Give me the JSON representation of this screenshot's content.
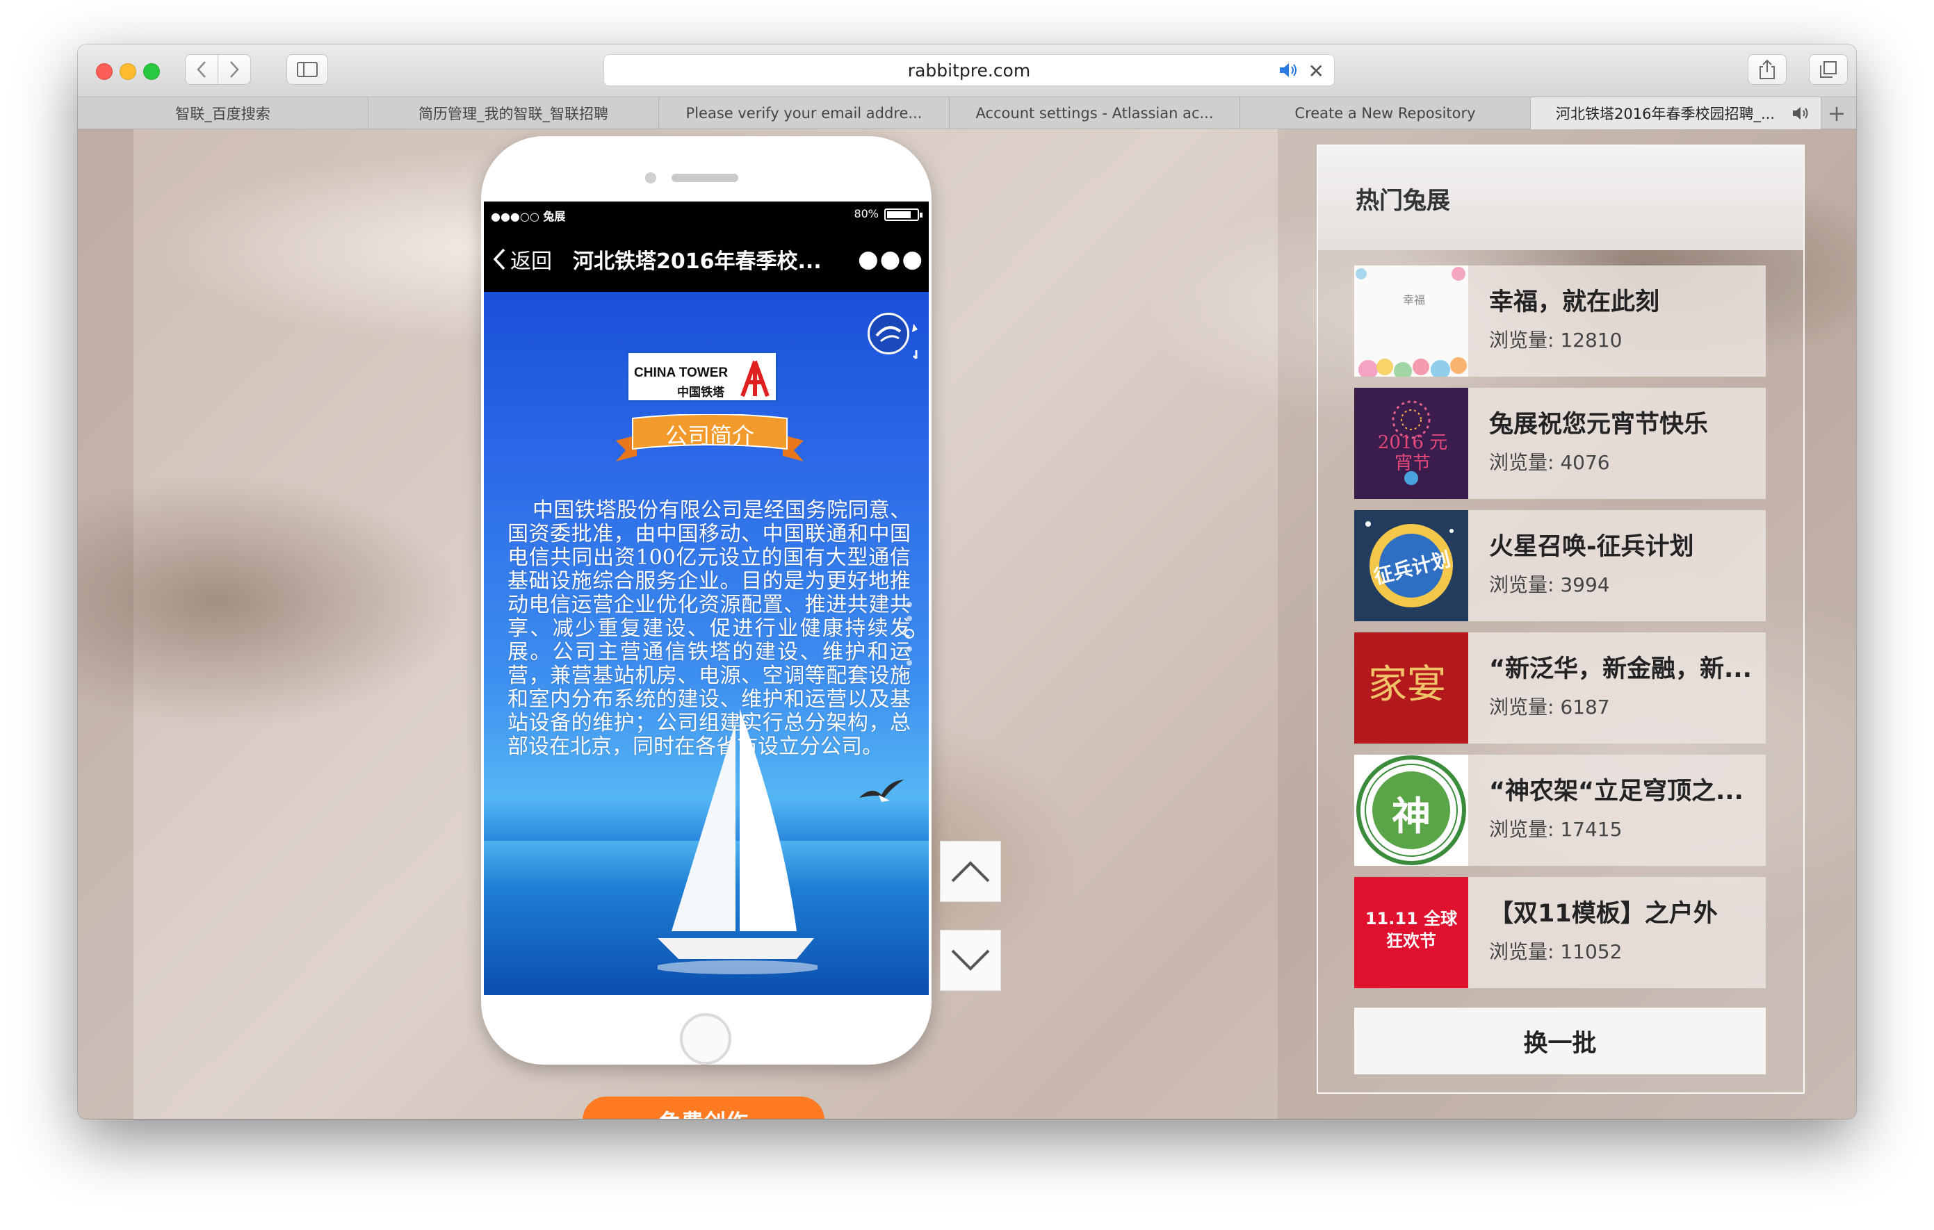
{
  "browser": {
    "url": "rabbitpre.com",
    "tabs": [
      {
        "label": "智联_百度搜索"
      },
      {
        "label": "简历管理_我的智联_智联招聘"
      },
      {
        "label": "Please verify your email addre..."
      },
      {
        "label": "Account settings - Atlassian ac..."
      },
      {
        "label": "Create a New Repository"
      },
      {
        "label": "河北铁塔2016年春季校园招聘_..."
      }
    ],
    "active_tab": 5
  },
  "phone": {
    "carrier": "●●●○○ 兔展",
    "battery": "80%",
    "battery_level": 0.8,
    "back_label": "返回",
    "title": "河北铁塔2016年春季校...",
    "more": "●●●",
    "logo_en": "CHINA TOWER",
    "logo_cn": "中国铁塔",
    "ribbon": "公司简介",
    "intro": "中国铁塔股份有限公司是经国务院同意、国资委批准，由中国移动、中国联通和中国电信共同出资100亿元设立的国有大型通信基础设施综合服务企业。目的是为更好地推动电信运营企业优化资源配置、推进共建共享、减少重复建设、促进行业健康持续发展。公司主营通信铁塔的建设、维护和运营，兼营基站机房、电源、空调等配套设施和室内分布系统的建设、维护和运营以及基站设备的维护；公司组建实行总分架构，总部设在北京，同时在各省市设立分公司。"
  },
  "free_create": "免费创作",
  "hot": {
    "title": "热门兔展",
    "items": [
      {
        "title": "幸福，就在此刻",
        "views": "浏览量: 12810",
        "thumb": "flowers-card",
        "thumb_text": "幸福"
      },
      {
        "title": "兔展祝您元宵节快乐",
        "views": "浏览量: 4076",
        "thumb": "lantern-festival",
        "thumb_text": "2016 元宵节"
      },
      {
        "title": "火星召唤-征兵计划",
        "views": "浏览量: 3994",
        "thumb": "mars-recruit",
        "thumb_text": "征兵计划"
      },
      {
        "title": "“新泛华，新金融，新...",
        "views": "浏览量: 6187",
        "thumb": "red-family",
        "thumb_text": "家宴"
      },
      {
        "title": "“神农架“立足穹顶之...",
        "views": "浏览量: 17415",
        "thumb": "shennongjia-seal",
        "thumb_text": "神"
      },
      {
        "title": "【双11模板】之户外",
        "views": "浏览量: 11052",
        "thumb": "double-11",
        "thumb_text": "11.11 全球狂欢节"
      }
    ],
    "refresh": "换一批"
  }
}
